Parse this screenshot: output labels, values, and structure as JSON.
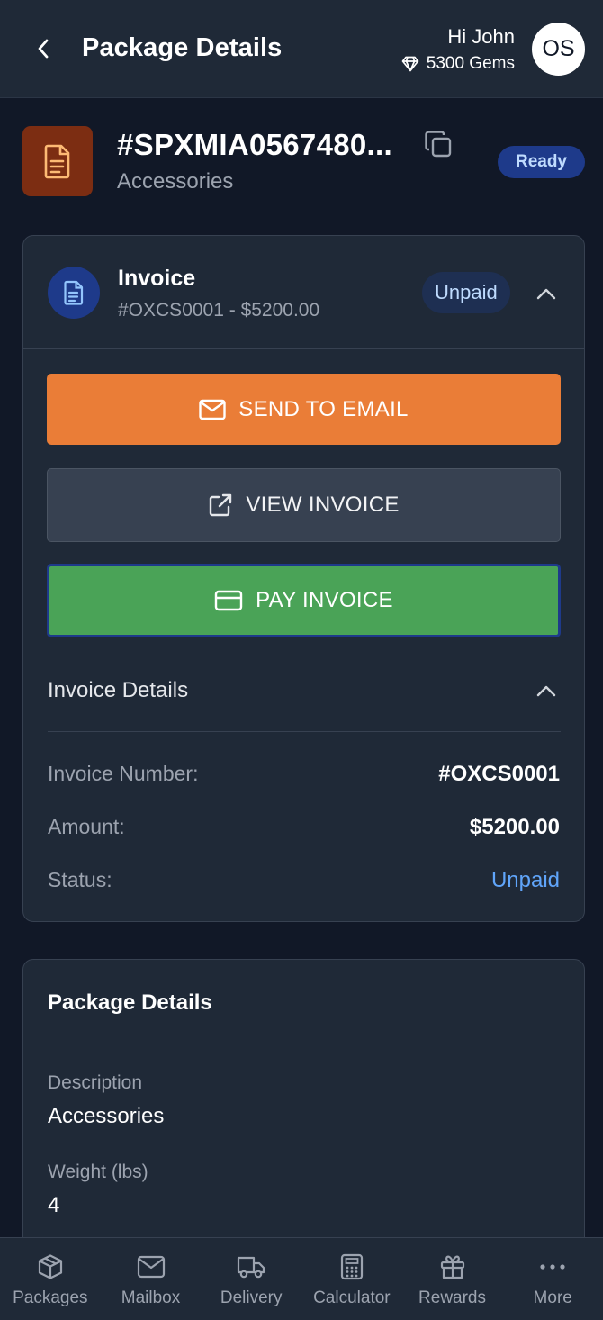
{
  "header": {
    "title": "Package Details",
    "greeting": "Hi John",
    "gems": "5300 Gems",
    "avatar_initials": "OS"
  },
  "package": {
    "id": "#SPXMIA0567480...",
    "category": "Accessories",
    "status": "Ready"
  },
  "invoice": {
    "title": "Invoice",
    "subtitle": "#OXCS0001 - $5200.00",
    "status_badge": "Unpaid",
    "buttons": {
      "send_email": "SEND TO EMAIL",
      "view": "VIEW INVOICE",
      "pay": "PAY INVOICE"
    },
    "details": {
      "title": "Invoice Details",
      "rows": [
        {
          "label": "Invoice Number:",
          "value": "#OXCS0001"
        },
        {
          "label": "Amount:",
          "value": "$5200.00"
        },
        {
          "label": "Status:",
          "value": "Unpaid"
        }
      ]
    }
  },
  "package_details": {
    "title": "Package Details",
    "fields": [
      {
        "label": "Description",
        "value": "Accessories"
      },
      {
        "label": "Weight (lbs)",
        "value": "4"
      }
    ]
  },
  "nav": {
    "items": [
      {
        "label": "Packages",
        "icon": "box-icon"
      },
      {
        "label": "Mailbox",
        "icon": "mail-icon"
      },
      {
        "label": "Delivery",
        "icon": "truck-icon"
      },
      {
        "label": "Calculator",
        "icon": "calculator-icon"
      },
      {
        "label": "Rewards",
        "icon": "gift-icon"
      },
      {
        "label": "More",
        "icon": "more-icon"
      }
    ]
  },
  "colors": {
    "background": "#111827",
    "surface": "#1f2937",
    "accent_orange": "#ea7d37",
    "pay_green": "#4aa357",
    "status_blue": "#60a5fa",
    "badge_blue": "#1e3a8a"
  }
}
